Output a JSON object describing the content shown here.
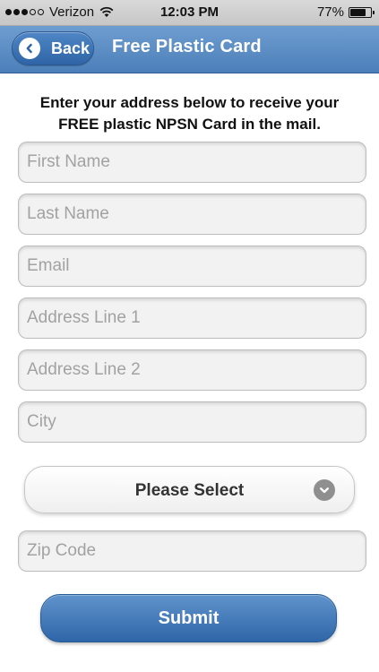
{
  "status_bar": {
    "carrier": "Verizon",
    "time": "12:03 PM",
    "battery_text": "77%",
    "battery_level": 0.77,
    "signal_bars_filled": 3,
    "signal_bars_total": 5
  },
  "nav": {
    "back_label": "Back",
    "title": "Free Plastic Card"
  },
  "intro": {
    "line1": "Enter your address below to receive your",
    "line2": "FREE plastic NPSN Card in the mail."
  },
  "form": {
    "first_name": {
      "placeholder": "First Name",
      "value": ""
    },
    "last_name": {
      "placeholder": "Last Name",
      "value": ""
    },
    "email": {
      "placeholder": "Email",
      "value": ""
    },
    "address1": {
      "placeholder": "Address Line 1",
      "value": ""
    },
    "address2": {
      "placeholder": "Address Line 2",
      "value": ""
    },
    "city": {
      "placeholder": "City",
      "value": ""
    },
    "state_select": {
      "selected": "Please Select"
    },
    "zip": {
      "placeholder": "Zip Code",
      "value": ""
    },
    "submit_label": "Submit"
  },
  "colors": {
    "nav_bar": "#5a8cc4",
    "accent_button": "#3f76b7",
    "field_background": "#f2f2f2",
    "placeholder_text": "#a2a2a2"
  },
  "icons": {
    "back": "chevron-left-circle-icon",
    "select": "chevron-down-circle-icon",
    "wifi": "wifi-icon",
    "battery": "battery-icon"
  }
}
